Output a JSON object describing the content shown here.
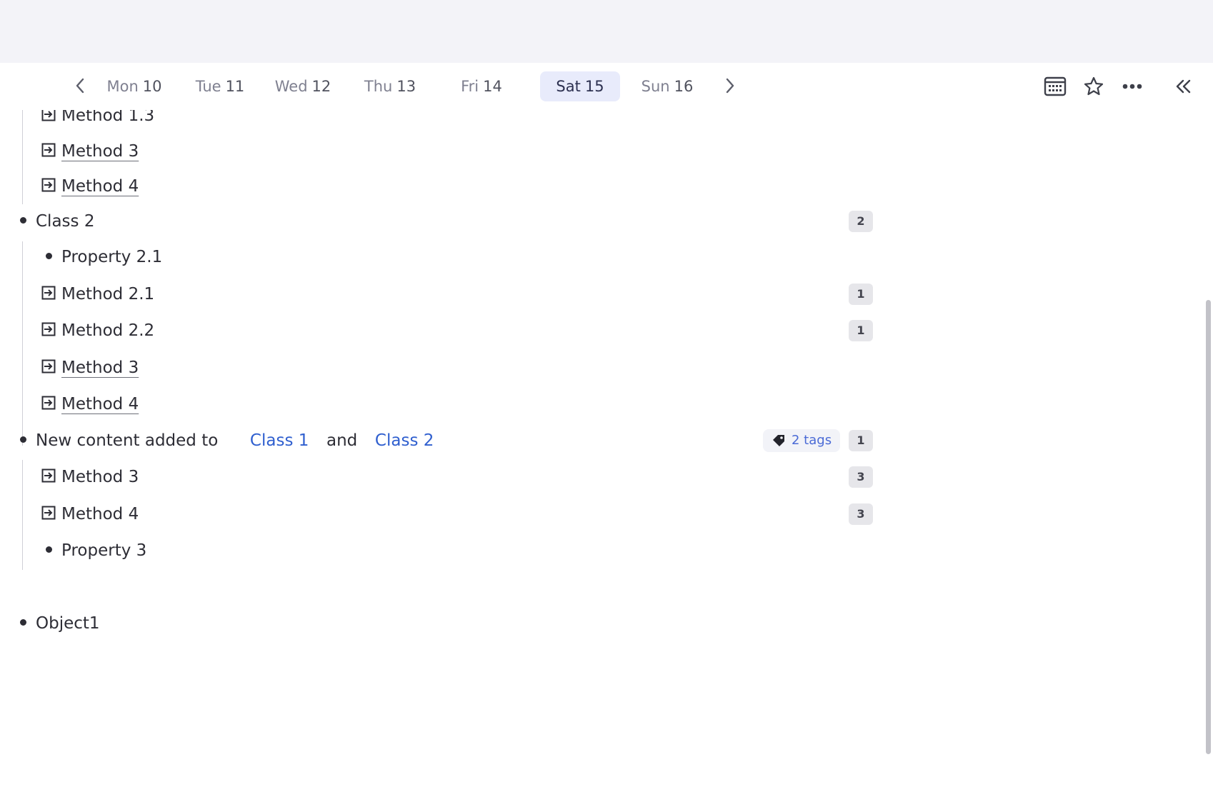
{
  "daybar": {
    "prev_icon": "chevron-left-icon",
    "next_icon": "chevron-right-icon",
    "days": [
      {
        "name": "Mon",
        "num": "10"
      },
      {
        "name": "Tue",
        "num": "11"
      },
      {
        "name": "Wed",
        "num": "12"
      },
      {
        "name": "Thu",
        "num": "13"
      },
      {
        "name": "Fri",
        "num": "14"
      },
      {
        "name": "Sat",
        "num": "15"
      },
      {
        "name": "Sun",
        "num": "16"
      }
    ],
    "selected_day": "Sat 15",
    "tools": [
      "calendar-icon",
      "star-icon",
      "more-icon",
      "collapse-panel-icon"
    ]
  },
  "outline": {
    "rows": [
      {
        "label": "Method 1.3",
        "icon": "method-icon",
        "level": 1
      },
      {
        "label": "Method 3",
        "icon": "method-icon",
        "level": 1,
        "underlined": true
      },
      {
        "label": "Method 4",
        "icon": "method-icon",
        "level": 1,
        "underlined": true
      },
      {
        "label": "Class 2",
        "icon": "bullet",
        "level": 0,
        "badge": "2"
      },
      {
        "label": "Property 2.1",
        "icon": "bullet",
        "level": 1
      },
      {
        "label": "Method 2.1",
        "icon": "method-icon",
        "level": 1,
        "badge": "1"
      },
      {
        "label": "Method 2.2",
        "icon": "method-icon",
        "level": 1,
        "badge": "1"
      },
      {
        "label": "Method 3",
        "icon": "method-icon",
        "level": 1,
        "underlined": true
      },
      {
        "label": "Method 4",
        "icon": "method-icon",
        "level": 1,
        "underlined": true
      },
      {
        "label": "New content added to",
        "link1": "Class 1",
        "joiner": "and",
        "link2": "Class 2",
        "icon": "bullet",
        "level": 0,
        "tags": "2 tags",
        "tag_icon": "tag-icon",
        "badge": "1"
      },
      {
        "label": "Method 3",
        "icon": "method-icon",
        "level": 1,
        "badge": "3"
      },
      {
        "label": "Method 4",
        "icon": "method-icon",
        "level": 1,
        "badge": "3"
      },
      {
        "label": "Property 3",
        "icon": "bullet",
        "level": 1
      },
      {
        "label": "Object1",
        "icon": "bullet",
        "level": 0
      }
    ]
  },
  "colors": {
    "accent": "#2f5fcf",
    "selected_day_bg": "#e8ebfb",
    "badge_bg": "#e6e6ea"
  }
}
